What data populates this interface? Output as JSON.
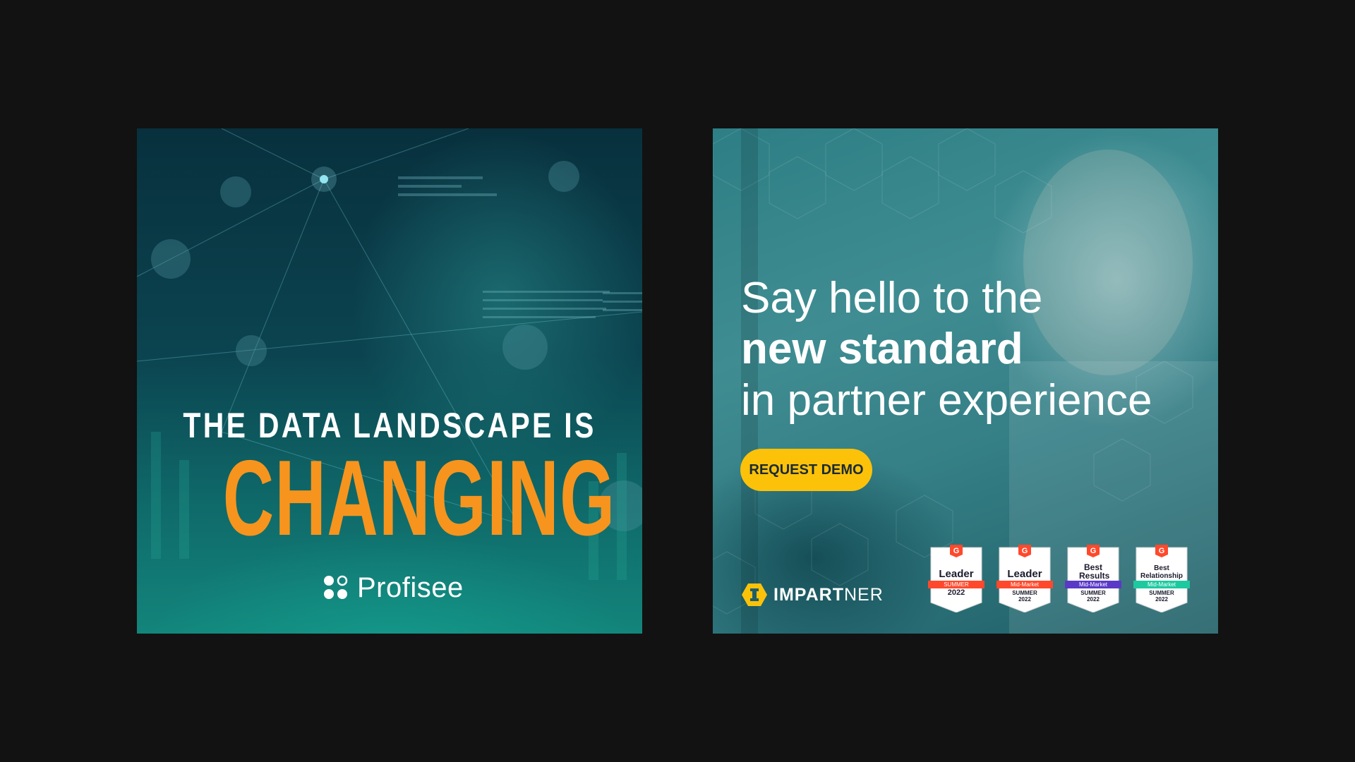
{
  "left_ad": {
    "headline_small": "THE DATA LANDSCAPE IS",
    "headline_big": "CHANGING",
    "brand_name": "Profisee",
    "colors": {
      "accent": "#f7941d",
      "background": "#0b4450"
    }
  },
  "right_ad": {
    "line1": "Say hello to the",
    "line2": "new standard",
    "line3": "in partner experience",
    "cta_label": "REQUEST DEMO",
    "logo": {
      "bold": "IMPART",
      "regular": "NER",
      "icon": "hexagon-i-icon"
    },
    "badges": [
      {
        "title": "Leader",
        "ribbon": "SUMMER",
        "season": "",
        "year": "2022",
        "ribbon_color": "#ff492c"
      },
      {
        "title": "Leader",
        "ribbon": "Mid-Market",
        "season": "SUMMER",
        "year": "2022",
        "ribbon_color": "#ff492c"
      },
      {
        "title": "Best Results",
        "ribbon": "Mid-Market",
        "season": "SUMMER",
        "year": "2022",
        "ribbon_color": "#5a39c7"
      },
      {
        "title": "Best Relationship",
        "ribbon": "Mid-Market",
        "season": "SUMMER",
        "year": "2022",
        "ribbon_color": "#1ec9a0"
      }
    ],
    "colors": {
      "cta": "#fcc20a",
      "background": "#3f8d92"
    }
  }
}
